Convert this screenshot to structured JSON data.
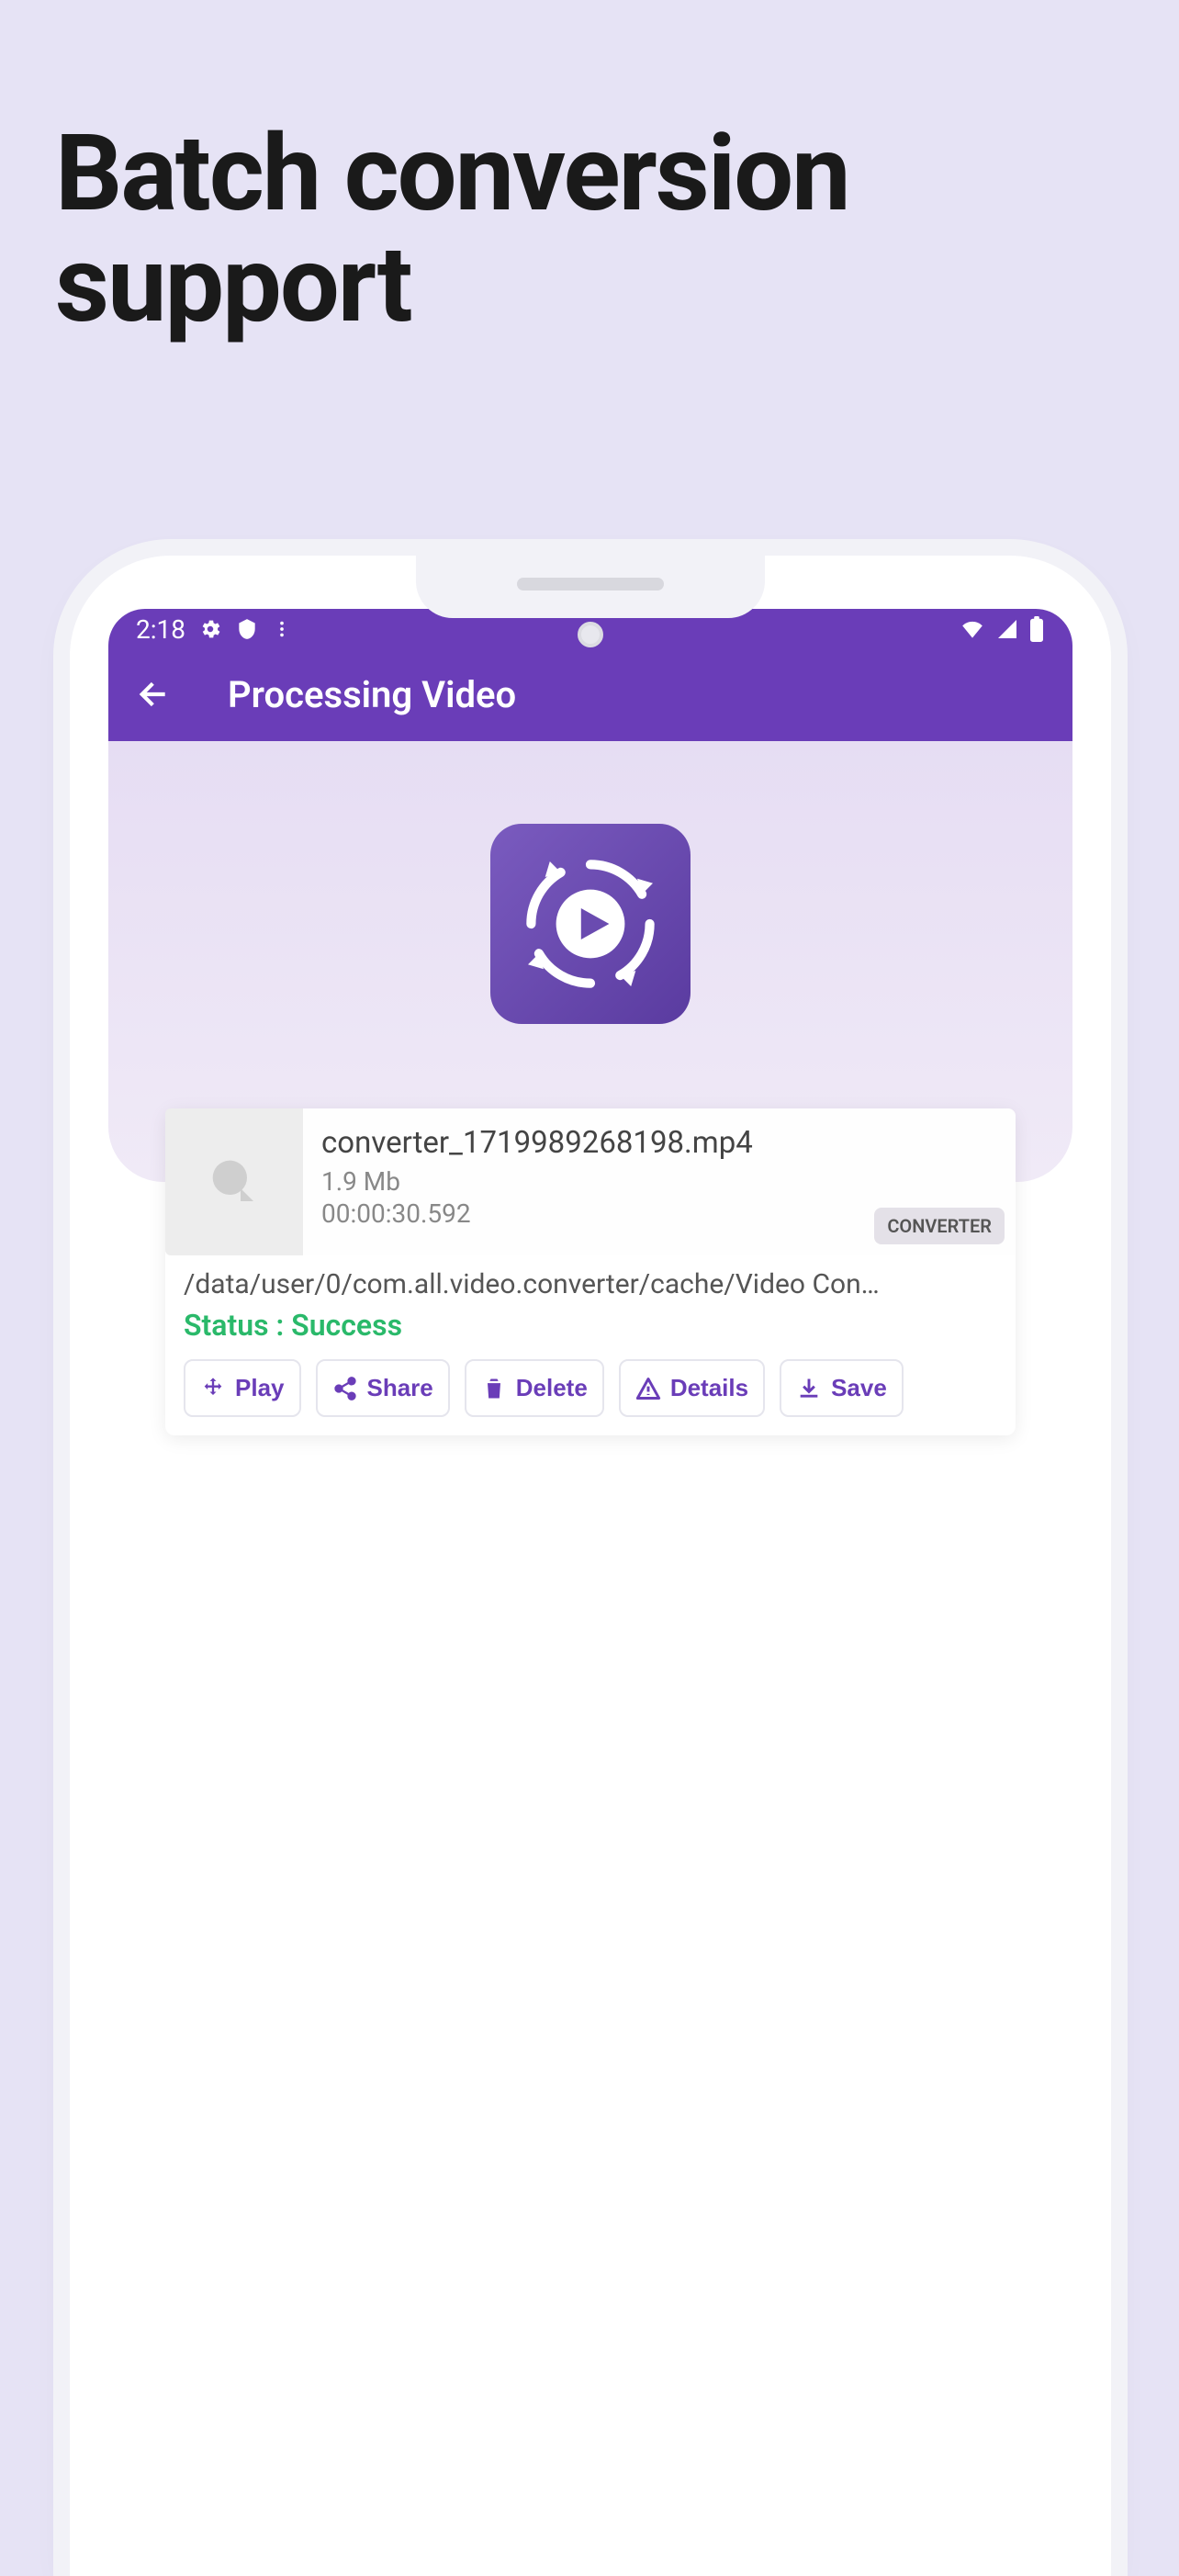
{
  "marketing": {
    "title": "Batch conversion support"
  },
  "statusbar": {
    "time": "2:18"
  },
  "appbar": {
    "title": "Processing Video"
  },
  "file": {
    "name": "converter_1719989268198.mp4",
    "size": "1.9 Mb",
    "duration": "00:00:30.592",
    "badge": "CONVERTER",
    "path": "/data/user/0/com.all.video.converter/cache/Video Con…",
    "status": "Status : Success"
  },
  "actions": {
    "play": "Play",
    "share": "Share",
    "delete": "Delete",
    "details": "Details",
    "save": "Save"
  }
}
